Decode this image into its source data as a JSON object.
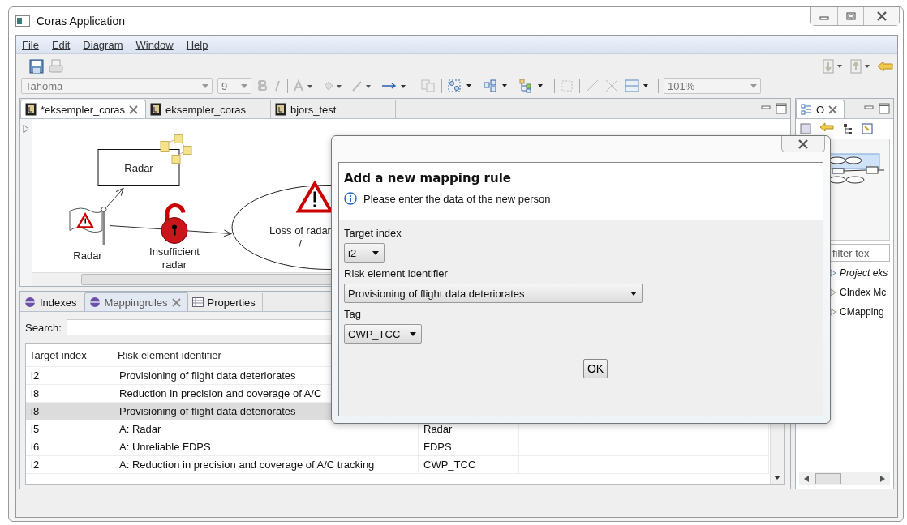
{
  "window": {
    "title": "Coras Application"
  },
  "menu": [
    "File",
    "Edit",
    "Diagram",
    "Window",
    "Help"
  ],
  "toolbar": {
    "font": "Tahoma",
    "size": "9",
    "zoom": "101%"
  },
  "editor_tabs": [
    {
      "label": "*eksempler_coras",
      "selected": true
    },
    {
      "label": "eksempler_coras",
      "selected": false
    },
    {
      "label": "bjors_test",
      "selected": false
    }
  ],
  "diagram": {
    "nodes": [
      {
        "kind": "asset",
        "lines": [
          "Radar"
        ]
      },
      {
        "kind": "threat",
        "lines": [
          "Radar"
        ]
      },
      {
        "kind": "vulnerability",
        "lines": [
          "Insufficient",
          "radar"
        ]
      },
      {
        "kind": "incident",
        "lines": [
          "Loss of radar",
          "/"
        ]
      }
    ]
  },
  "bottom_tabs": [
    {
      "label": "Indexes",
      "selected": false
    },
    {
      "label": "Mappingrules",
      "selected": true
    },
    {
      "label": "Properties",
      "selected": false
    }
  ],
  "search": {
    "label": "Search:"
  },
  "table": {
    "columns": [
      "Target index",
      "Risk element identifier"
    ],
    "rows": [
      {
        "target": "i2",
        "risk": "Provisioning of flight data deteriorates",
        "selected": false
      },
      {
        "target": "i8",
        "risk": "Reduction in precision and coverage of A/C",
        "selected": false
      },
      {
        "target": "i8",
        "risk": "Provisioning of flight data deteriorates",
        "selected": true
      },
      {
        "target": "i5",
        "risk": "A: Radar",
        "tag": "Radar",
        "selected": false
      },
      {
        "target": "i6",
        "risk": "A: Unreliable FDPS",
        "tag": "FDPS",
        "selected": false
      },
      {
        "target": "i2",
        "risk": "A: Reduction in precision and coverage of A/C tracking",
        "tag": "CWP_TCC",
        "selected": false
      }
    ]
  },
  "outline": {
    "tab": "O",
    "filter_placeholder": "filter tex",
    "tree": [
      {
        "label": "Project eks",
        "kind": "project"
      },
      {
        "label": "CIndex Mc",
        "kind": "class"
      },
      {
        "label": "CMapping",
        "kind": "class"
      }
    ]
  },
  "dialog": {
    "title": "Add a new mapping rule",
    "message": "Please enter the data of the new person",
    "fields": [
      {
        "label": "Target index",
        "value": "i2"
      },
      {
        "label": "Risk element identifier",
        "value": "Provisioning of flight data deteriorates"
      },
      {
        "label": "Tag",
        "value": "CWP_TCC"
      }
    ],
    "ok": "OK"
  }
}
